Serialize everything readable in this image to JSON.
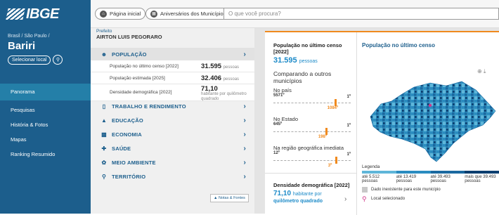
{
  "header": {
    "logo": "IBGE",
    "home": "Página inicial",
    "birthdays": "Aniversários dos Municípios",
    "search_placeholder": "O que você procura?"
  },
  "sidebar": {
    "breadcrumb": "Brasil / São Paulo /",
    "city": "Bariri",
    "select_local": "Selecionar local",
    "items": [
      {
        "label": "Panorama"
      },
      {
        "label": "Pesquisas"
      },
      {
        "label": "História & Fotos"
      },
      {
        "label": "Mapas"
      },
      {
        "label": "Ranking Resumido"
      }
    ]
  },
  "panel": {
    "prefeito_label": "Prefeito",
    "prefeito": "AIRTON LUIS PEGORARO",
    "population": {
      "title": "POPULAÇÃO",
      "rows": [
        {
          "label": "População no último censo [2022]",
          "value": "31.595",
          "unit": "pessoas"
        },
        {
          "label": "População estimada [2025]",
          "value": "32.406",
          "unit": "pessoas"
        },
        {
          "label": "Densidade demográfica [2022]",
          "value": "71,10",
          "unit": "habitante por quilômetro quadrado"
        }
      ]
    },
    "categories": [
      "TRABALHO E RENDIMENTO",
      "EDUCAÇÃO",
      "ECONOMIA",
      "SAÚDE",
      "MEIO AMBIENTE",
      "TERRITÓRIO"
    ],
    "notas": "Notas & Fontes"
  },
  "card": {
    "title": "População no último censo [2022]",
    "value": "31.595",
    "unit": "pessoas",
    "compare": "Comparando a outros municípios",
    "rankings": [
      {
        "label": "No país",
        "range_low": "5571º",
        "range_high": "1º",
        "value": "1084º",
        "position": 0.81
      },
      {
        "label": "No Estado",
        "range_low": "645º",
        "range_high": "1º",
        "value": "198º",
        "position": 0.69
      },
      {
        "label": "Na região geográfica imediata",
        "range_low": "12º",
        "range_high": "1º",
        "value": "3º",
        "position": 0.82
      }
    ],
    "density": {
      "title": "Densidade demográfica [2022]",
      "value": "71,10",
      "unit": "habitante por",
      "unit2": "quilômetro quadrado"
    }
  },
  "map": {
    "title": "População no último censo",
    "legend_title": "Legenda",
    "bins": [
      "até 5.512 pessoas",
      "até 13.419 pessoas",
      "até 39.493 pessoas",
      "mais que 39.493 pessoas"
    ],
    "colors": [
      "#5fb6d9",
      "#2a8cc0",
      "#1b69a0",
      "#0c3f70"
    ],
    "missing": "Dado inexistente para este município",
    "selected": "Local selecionado"
  }
}
